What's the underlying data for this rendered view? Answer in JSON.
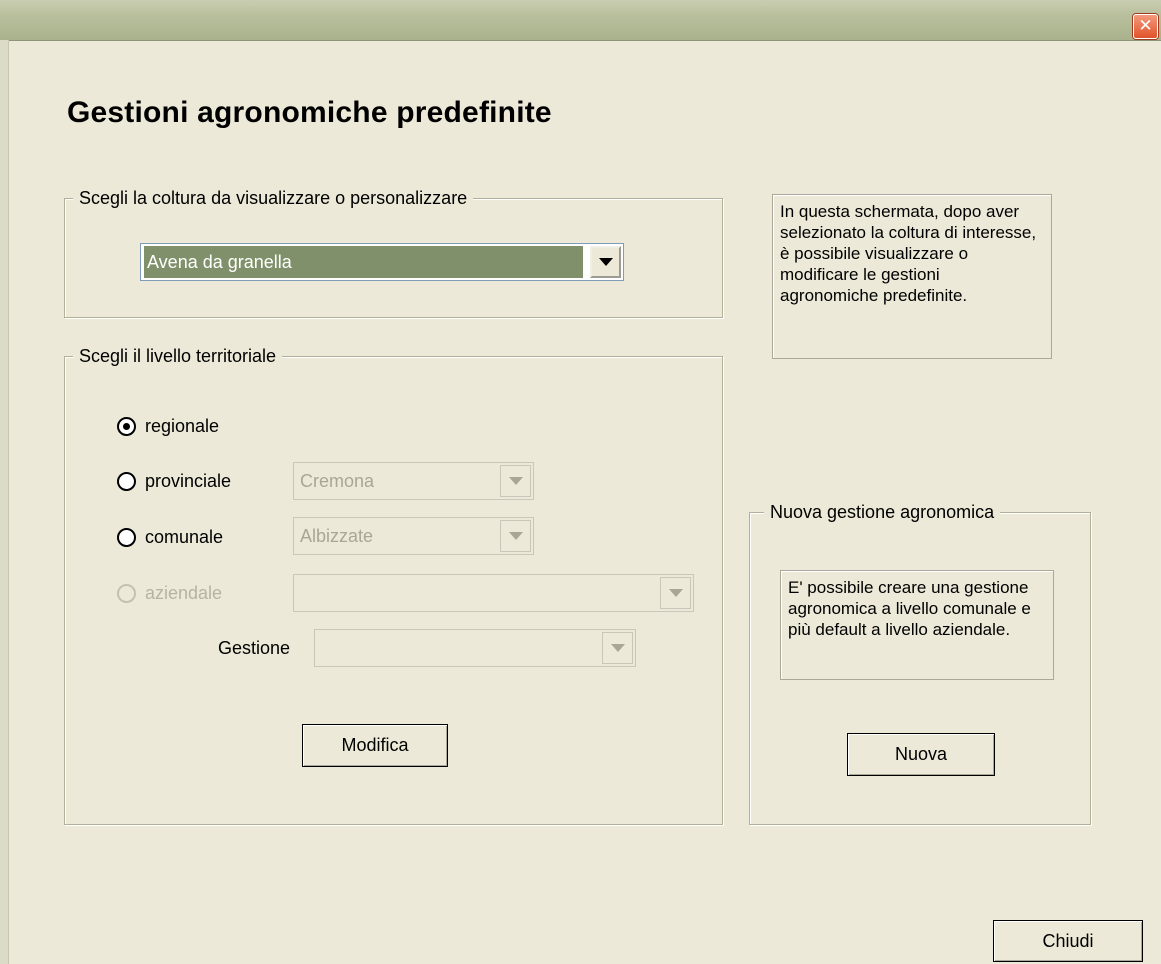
{
  "window": {
    "close_glyph": "✕"
  },
  "page_title": "Gestioni agronomiche predefinite",
  "crop_group": {
    "legend": "Scegli la coltura da visualizzare o personalizzare",
    "crop_combo": {
      "value": "Avena da granella"
    }
  },
  "level_group": {
    "legend": "Scegli il livello territoriale",
    "radios": {
      "regionale": {
        "label": "regionale",
        "checked": true
      },
      "provinciale": {
        "label": "provinciale",
        "checked": false
      },
      "comunale": {
        "label": "comunale",
        "checked": false
      },
      "aziendale": {
        "label": "aziendale",
        "checked": false,
        "disabled": true
      }
    },
    "provincia_combo": {
      "value": "Cremona"
    },
    "comune_combo": {
      "value": "Albizzate"
    },
    "azienda_combo": {
      "value": ""
    },
    "gestione_label": "Gestione",
    "gestione_combo": {
      "value": ""
    },
    "modifica_label": "Modifica"
  },
  "help_text": "In questa schermata, dopo aver selezionato la coltura di interesse, è possibile visualizzare o modificare le gestioni agronomiche predefinite.",
  "new_group": {
    "legend": "Nuova gestione agronomica",
    "info_text": "E' possibile creare una gestione agronomica a livello comunale e più default a livello aziendale.",
    "nuova_label": "Nuova"
  },
  "chiudi_label": "Chiudi",
  "colors": {
    "background": "#ece9d8",
    "selection": "#7f906a",
    "close_button": "#e0532a"
  }
}
